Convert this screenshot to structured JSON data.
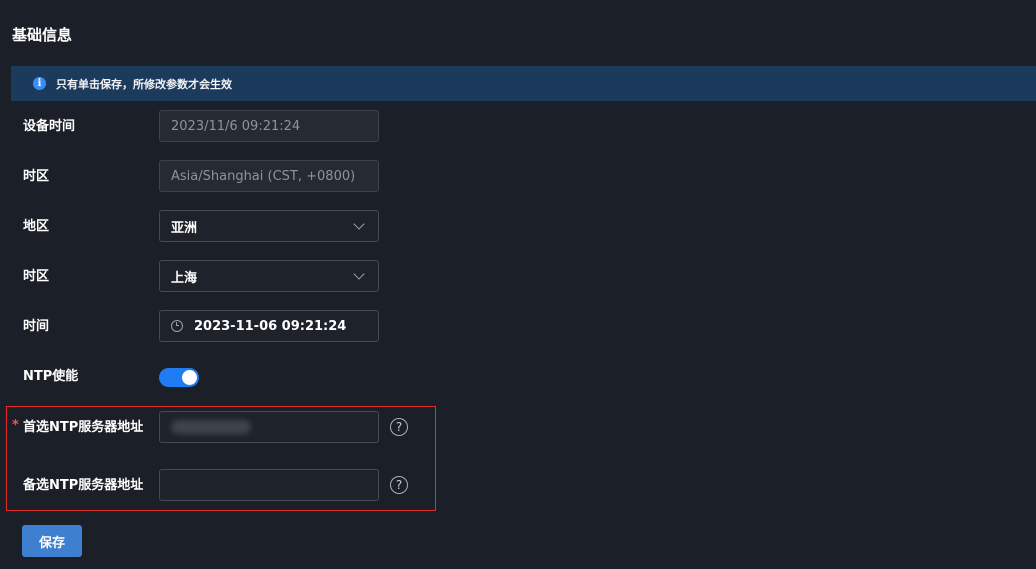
{
  "page": {
    "title": "基础信息"
  },
  "notice": {
    "icon": "info-icon",
    "text": "只有单击保存，所修改参数才会生效"
  },
  "form": {
    "device_time": {
      "label": "设备时间",
      "value": "2023/11/6 09:21:24"
    },
    "timezone_display": {
      "label": "时区",
      "value": "Asia/Shanghai (CST, +0800)"
    },
    "region": {
      "label": "地区",
      "value": "亚洲"
    },
    "timezone_city": {
      "label": "时区",
      "value": "上海"
    },
    "time": {
      "label": "时间",
      "value": "2023-11-06 09:21:24",
      "icon": "clock-icon"
    },
    "ntp_enable": {
      "label": "NTP使能",
      "enabled": true
    },
    "ntp_primary": {
      "label": "首选NTP服务器地址",
      "required_mark": "*",
      "value": "",
      "help_icon": "?"
    },
    "ntp_secondary": {
      "label": "备选NTP服务器地址",
      "value": "",
      "help_icon": "?"
    }
  },
  "actions": {
    "save_label": "保存"
  },
  "colors": {
    "background": "#1b1f27",
    "notice_bg": "#1c3a5c",
    "accent": "#1f7cf2",
    "save_button": "#3f7fd0",
    "highlight_border": "#e22b2b"
  }
}
